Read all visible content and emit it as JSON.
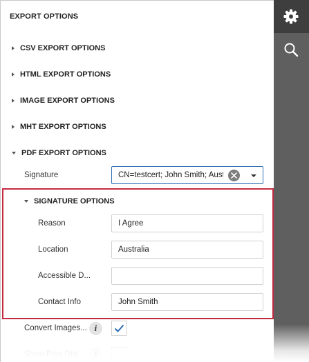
{
  "panel": {
    "title": "EXPORT OPTIONS",
    "sections": [
      {
        "label": "CSV EXPORT OPTIONS",
        "expanded": false
      },
      {
        "label": "HTML EXPORT OPTIONS",
        "expanded": false
      },
      {
        "label": "IMAGE EXPORT OPTIONS",
        "expanded": false
      },
      {
        "label": "MHT EXPORT OPTIONS",
        "expanded": false
      },
      {
        "label": "PDF EXPORT OPTIONS",
        "expanded": true
      }
    ],
    "signature": {
      "label": "Signature",
      "value": "CN=testcert; John Smith; Australia"
    },
    "signature_options": {
      "title": "SIGNATURE OPTIONS",
      "reason_label": "Reason",
      "reason_value": "I Agree",
      "location_label": "Location",
      "location_value": "Australia",
      "accessible_label": "Accessible D...",
      "accessible_value": "",
      "contact_label": "Contact Info",
      "contact_value": "John Smith"
    },
    "convert_images": {
      "label": "Convert Images...",
      "checked": true
    },
    "show_print": {
      "label": "Show Print Dial...",
      "checked": false
    },
    "info_glyph": "i"
  },
  "toolbar": {
    "items": [
      {
        "icon": "gear-icon",
        "active": true
      },
      {
        "icon": "search-icon",
        "active": false
      }
    ]
  },
  "colors": {
    "accent": "#2d6fb4",
    "highlight": "#c42b3f",
    "toolbar": "#5f5f5f",
    "toolbar_active": "#3e3e3e"
  }
}
